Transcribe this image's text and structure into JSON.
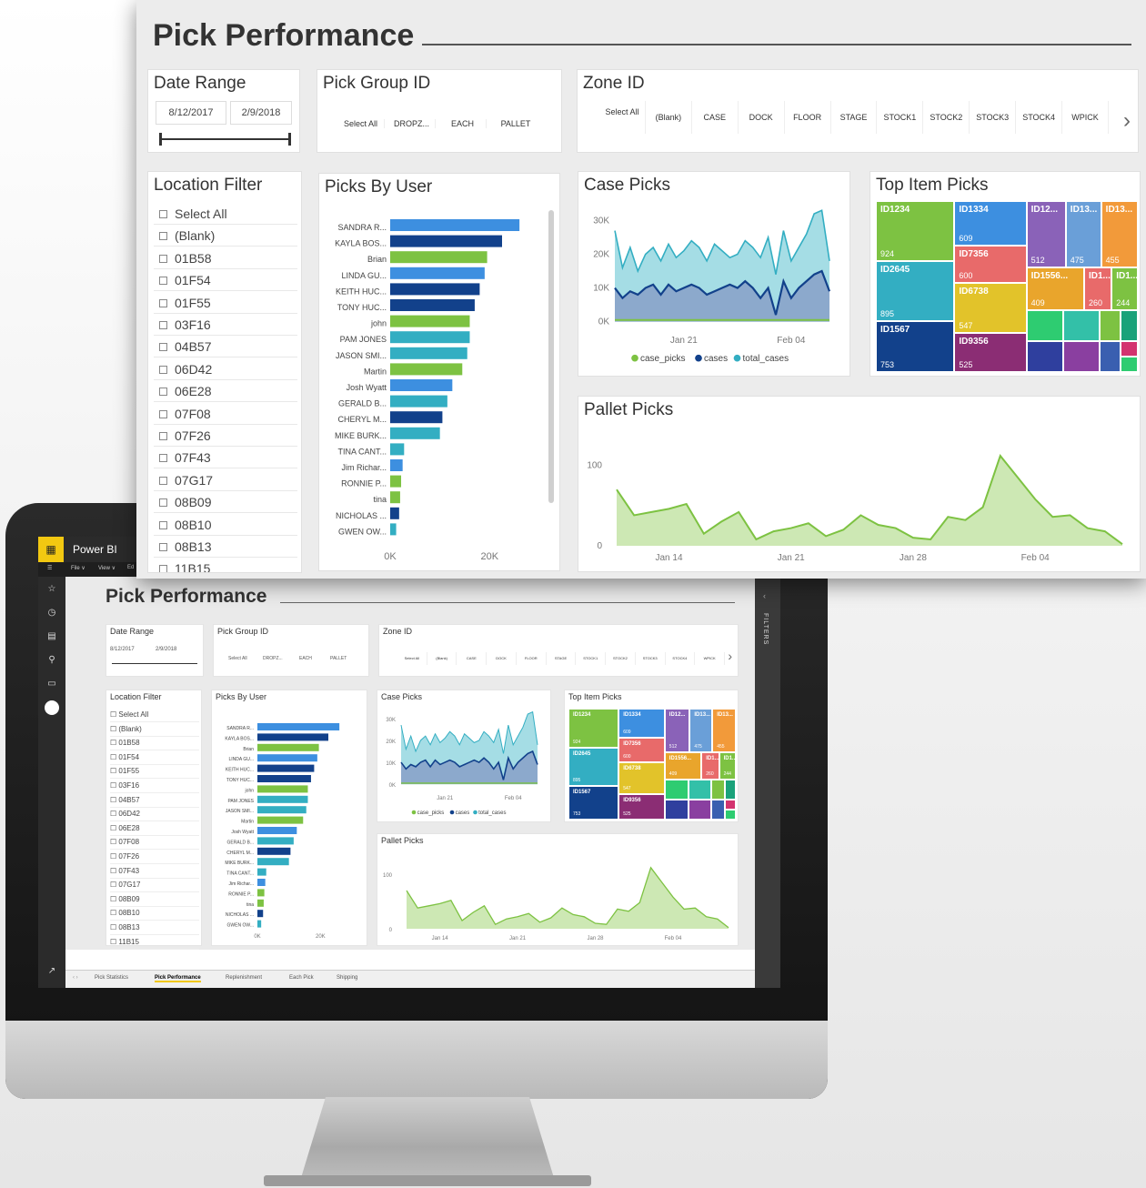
{
  "app": {
    "name": "Power BI",
    "menu": [
      "File ∨",
      "View ∨",
      "Ed"
    ],
    "tabs": [
      "Pick Statistics",
      "Pick Performance",
      "Replenishment",
      "Each Pick",
      "Shipping"
    ],
    "active_tab": "Pick Performance",
    "filters_label": "FILTERS"
  },
  "report": {
    "title": "Pick Performance",
    "date_range": {
      "title": "Date Range",
      "start": "8/12/2017",
      "end": "2/9/2018"
    },
    "pick_group": {
      "title": "Pick Group ID",
      "options": [
        "Select All",
        "DROPZ...",
        "EACH",
        "PALLET"
      ]
    },
    "zone": {
      "title": "Zone ID",
      "options": [
        "Select All",
        "(Blank)",
        "CASE",
        "DOCK",
        "FLOOR",
        "STAGE",
        "STOCK1",
        "STOCK2",
        "STOCK3",
        "STOCK4",
        "WPICK"
      ],
      "next_icon": "chevron-right"
    },
    "location_filter": {
      "title": "Location Filter",
      "items": [
        "Select All",
        "(Blank)",
        "01B58",
        "01F54",
        "01F55",
        "03F16",
        "04B57",
        "06D42",
        "06E28",
        "07F08",
        "07F26",
        "07F43",
        "07G17",
        "08B09",
        "08B10",
        "08B13",
        "11B15"
      ]
    },
    "picks_by_user": {
      "title": "Picks By User"
    },
    "case_picks": {
      "title": "Case Picks"
    },
    "top_item_picks": {
      "title": "Top Item Picks"
    },
    "pallet_picks": {
      "title": "Pallet Picks"
    }
  },
  "colors": {
    "green": "#7dc242",
    "dark_blue": "#12418b",
    "mid_blue": "#3d8fe0",
    "teal": "#33aec2",
    "light_teal": "#8fd4df",
    "pallet_fill": "#cde8b4"
  },
  "chart_data": [
    {
      "type": "bar",
      "orientation": "horizontal",
      "title": "Picks By User",
      "categories": [
        "SANDRA R...",
        "KAYLA BOS...",
        "Brian",
        "LINDA GU...",
        "KEITH HUC...",
        "TONY HUC...",
        "john",
        "PAM JONES",
        "JASON SMI...",
        "Martin",
        "Josh Wyatt",
        "GERALD B...",
        "CHERYL M...",
        "MIKE BURK...",
        "TINA CANT...",
        "Jim Richar...",
        "RONNIE P...",
        "tina",
        "NICHOLAS ...",
        "GWEN OW..."
      ],
      "values": [
        26000,
        22500,
        19500,
        19000,
        18000,
        17000,
        16000,
        16000,
        15500,
        14500,
        12500,
        11500,
        10500,
        10000,
        2800,
        2500,
        2200,
        2000,
        1800,
        1200
      ],
      "bar_colors": [
        "#3d8fe0",
        "#12418b",
        "#7dc242",
        "#3d8fe0",
        "#12418b",
        "#12418b",
        "#7dc242",
        "#33aec2",
        "#33aec2",
        "#7dc242",
        "#3d8fe0",
        "#33aec2",
        "#12418b",
        "#33aec2",
        "#33aec2",
        "#3d8fe0",
        "#7dc242",
        "#7dc242",
        "#12418b",
        "#33aec2"
      ],
      "x_ticks": [
        "0K",
        "20K"
      ],
      "xlim": [
        0,
        30000
      ]
    },
    {
      "type": "area",
      "title": "Case Picks",
      "x": [
        "Jan 12",
        "Jan 13",
        "Jan 14",
        "Jan 15",
        "Jan 16",
        "Jan 17",
        "Jan 18",
        "Jan 19",
        "Jan 20",
        "Jan 21",
        "Jan 22",
        "Jan 23",
        "Jan 24",
        "Jan 25",
        "Jan 26",
        "Jan 27",
        "Jan 28",
        "Jan 29",
        "Jan 30",
        "Jan 31",
        "Feb 01",
        "Feb 02",
        "Feb 03",
        "Feb 04",
        "Feb 05",
        "Feb 06",
        "Feb 07",
        "Feb 08",
        "Feb 09"
      ],
      "x_ticks": [
        "Jan 21",
        "Feb 04"
      ],
      "y_ticks": [
        "30K",
        "20K",
        "10K",
        "0K"
      ],
      "ylim": [
        -2000,
        32000
      ],
      "series": [
        {
          "name": "total_cases",
          "color": "#8fd4df",
          "values": [
            27000,
            16000,
            22000,
            15000,
            20000,
            22000,
            18000,
            23000,
            19000,
            21000,
            24000,
            22000,
            18000,
            23000,
            21000,
            19000,
            20000,
            24000,
            22000,
            19000,
            25000,
            14000,
            27000,
            18000,
            22000,
            26000,
            32000,
            33000,
            18000
          ]
        },
        {
          "name": "cases",
          "color": "#12418b",
          "values": [
            10000,
            7000,
            9000,
            8000,
            10000,
            11000,
            8000,
            11000,
            9000,
            10000,
            11000,
            10000,
            8000,
            9000,
            10000,
            11000,
            10000,
            12000,
            10000,
            7000,
            10000,
            2000,
            12000,
            7000,
            10000,
            12000,
            14000,
            15000,
            9000
          ]
        },
        {
          "name": "case_picks",
          "color": "#7dc242",
          "values": [
            500,
            500,
            500,
            500,
            500,
            500,
            500,
            500,
            500,
            500,
            500,
            500,
            500,
            500,
            500,
            500,
            500,
            500,
            500,
            500,
            500,
            500,
            500,
            500,
            500,
            500,
            500,
            500,
            500
          ]
        }
      ]
    },
    {
      "type": "treemap",
      "title": "Top Item Picks",
      "items": [
        {
          "label": "ID1234",
          "value": 924,
          "color": "#7dc242"
        },
        {
          "label": "ID2645",
          "value": 895,
          "color": "#33aec2"
        },
        {
          "label": "ID1567",
          "value": 753,
          "color": "#12418b"
        },
        {
          "label": "ID1334",
          "value": 609,
          "color": "#3d8fe0"
        },
        {
          "label": "ID7356",
          "value": 600,
          "color": "#e86a6a"
        },
        {
          "label": "ID6738",
          "value": 547,
          "color": "#e2c32a"
        },
        {
          "label": "ID9356",
          "value": 525,
          "color": "#8b2d74"
        },
        {
          "label": "ID12...",
          "value": 512,
          "color": "#8a62b8"
        },
        {
          "label": "ID13...",
          "value": 475,
          "color": "#6a9fd8"
        },
        {
          "label": "ID13...",
          "value": 455,
          "color": "#f29a3a"
        },
        {
          "label": "ID1556...",
          "value": 409,
          "color": "#e9a52c"
        },
        {
          "label": "ID1...",
          "value": 260,
          "color": "#e86a6a"
        },
        {
          "label": "ID1...",
          "value": 244,
          "color": "#7dc242"
        }
      ]
    },
    {
      "type": "area",
      "title": "Pallet Picks",
      "x": [
        "Jan 11",
        "Jan 12",
        "Jan 13",
        "Jan 14",
        "Jan 15",
        "Jan 16",
        "Jan 17",
        "Jan 18",
        "Jan 19",
        "Jan 20",
        "Jan 21",
        "Jan 22",
        "Jan 23",
        "Jan 24",
        "Jan 25",
        "Jan 26",
        "Jan 27",
        "Jan 28",
        "Jan 29",
        "Jan 30",
        "Jan 31",
        "Feb 01",
        "Feb 02",
        "Feb 03",
        "Feb 04",
        "Feb 05",
        "Feb 06",
        "Feb 07",
        "Feb 08"
      ],
      "x_ticks": [
        "Jan 14",
        "Jan 21",
        "Jan 28",
        "Feb 04"
      ],
      "y_ticks": [
        "100",
        "0"
      ],
      "ylim": [
        0,
        120
      ],
      "series": [
        {
          "name": "pallet_picks",
          "color": "#7dc242",
          "values": [
            70,
            38,
            42,
            46,
            52,
            15,
            30,
            42,
            8,
            18,
            22,
            28,
            12,
            20,
            38,
            26,
            22,
            10,
            8,
            36,
            32,
            48,
            112,
            85,
            58,
            36,
            38,
            22,
            18,
            2
          ]
        }
      ]
    }
  ]
}
